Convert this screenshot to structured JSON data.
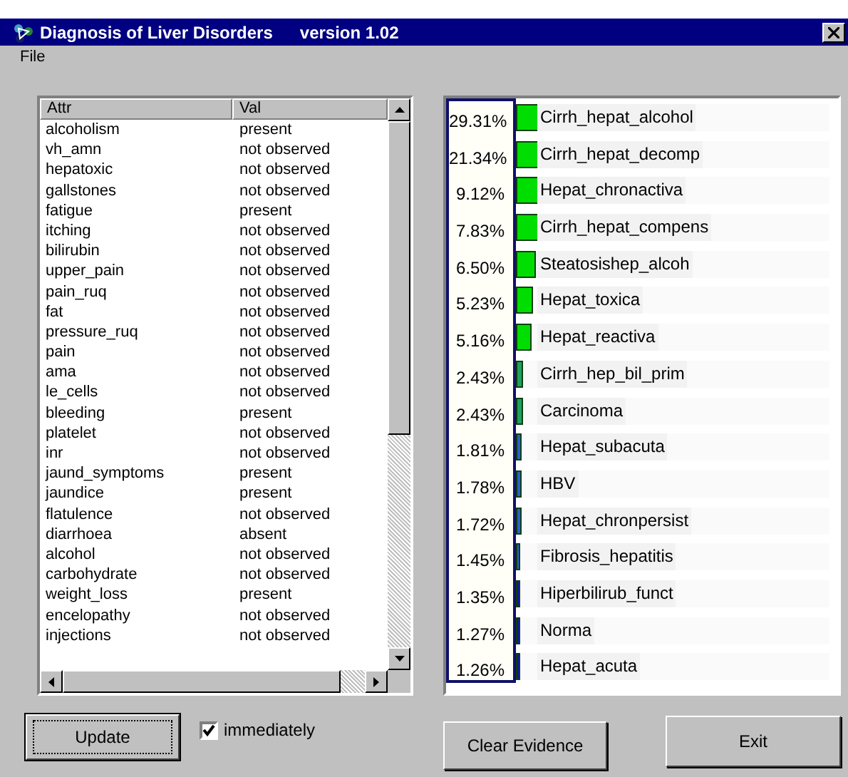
{
  "window": {
    "title": "Diagnosis of Liver Disorders",
    "version": "version 1.02"
  },
  "menu": [
    "File"
  ],
  "evidence": {
    "columns": [
      "Attr",
      "Val"
    ],
    "rows": [
      [
        "alcoholism",
        "present"
      ],
      [
        "vh_amn",
        "not observed"
      ],
      [
        "hepatoxic",
        "not observed"
      ],
      [
        "gallstones",
        "not observed"
      ],
      [
        "fatigue",
        "present"
      ],
      [
        "itching",
        "not observed"
      ],
      [
        "bilirubin",
        "not observed"
      ],
      [
        "upper_pain",
        "not observed"
      ],
      [
        "pain_ruq",
        "not observed"
      ],
      [
        "fat",
        "not observed"
      ],
      [
        "pressure_ruq",
        "not observed"
      ],
      [
        "pain",
        "not observed"
      ],
      [
        "ama",
        "not observed"
      ],
      [
        "le_cells",
        "not observed"
      ],
      [
        "bleeding",
        "present"
      ],
      [
        "platelet",
        "not observed"
      ],
      [
        "inr",
        "not observed"
      ],
      [
        "jaund_symptoms",
        "present"
      ],
      [
        "jaundice",
        "present"
      ],
      [
        "flatulence",
        "not observed"
      ],
      [
        "diarrhoea",
        "absent"
      ],
      [
        "alcohol",
        "not observed"
      ],
      [
        "carbohydrate",
        "not observed"
      ],
      [
        "weight_loss",
        "present"
      ],
      [
        "encelopathy",
        "not observed"
      ],
      [
        "injections",
        "not observed"
      ]
    ]
  },
  "update_button": "Update",
  "immediately": {
    "label": "immediately",
    "checked": true
  },
  "results": [
    {
      "percent": "29.31%",
      "name": "Cirrh_hepat_alcohol",
      "level": 0.2931,
      "color": "#00dd00"
    },
    {
      "percent": "21.34%",
      "name": "Cirrh_hepat_decomp",
      "level": 0.2134,
      "color": "#00dd00"
    },
    {
      "percent": "9.12%",
      "name": "Hepat_chronactiva",
      "level": 0.0912,
      "color": "#00dd00"
    },
    {
      "percent": "7.83%",
      "name": "Cirrh_hepat_compens",
      "level": 0.0783,
      "color": "#00dd00"
    },
    {
      "percent": "6.50%",
      "name": "Steatosishep_alcoh",
      "level": 0.065,
      "color": "#00dd00"
    },
    {
      "percent": "5.23%",
      "name": "Hepat_toxica",
      "level": 0.0523,
      "color": "#00dd00"
    },
    {
      "percent": "5.16%",
      "name": "Hepat_reactiva",
      "level": 0.0516,
      "color": "#00dd00"
    },
    {
      "percent": "2.43%",
      "name": "Cirrh_hep_bil_prim",
      "level": 0.0243,
      "color": "#20a060"
    },
    {
      "percent": "2.43%",
      "name": "Carcinoma",
      "level": 0.0243,
      "color": "#20a060"
    },
    {
      "percent": "1.81%",
      "name": "Hepat_subacuta",
      "level": 0.0181,
      "color": "#2a5fd0"
    },
    {
      "percent": "1.78%",
      "name": "HBV",
      "level": 0.0178,
      "color": "#2a5fd0"
    },
    {
      "percent": "1.72%",
      "name": "Hepat_chronpersist",
      "level": 0.0172,
      "color": "#2a5fd0"
    },
    {
      "percent": "1.45%",
      "name": "Fibrosis_hepatitis",
      "level": 0.0145,
      "color": "#2a5fd0"
    },
    {
      "percent": "1.35%",
      "name": "Hiperbilirub_funct",
      "level": 0.0135,
      "color": "#1010c0"
    },
    {
      "percent": "1.27%",
      "name": "Norma",
      "level": 0.0127,
      "color": "#1010c0"
    },
    {
      "percent": "1.26%",
      "name": "Hepat_acuta",
      "level": 0.0126,
      "color": "#1010c0"
    }
  ],
  "buttons": [
    "Clear Evidence",
    "Exit"
  ]
}
